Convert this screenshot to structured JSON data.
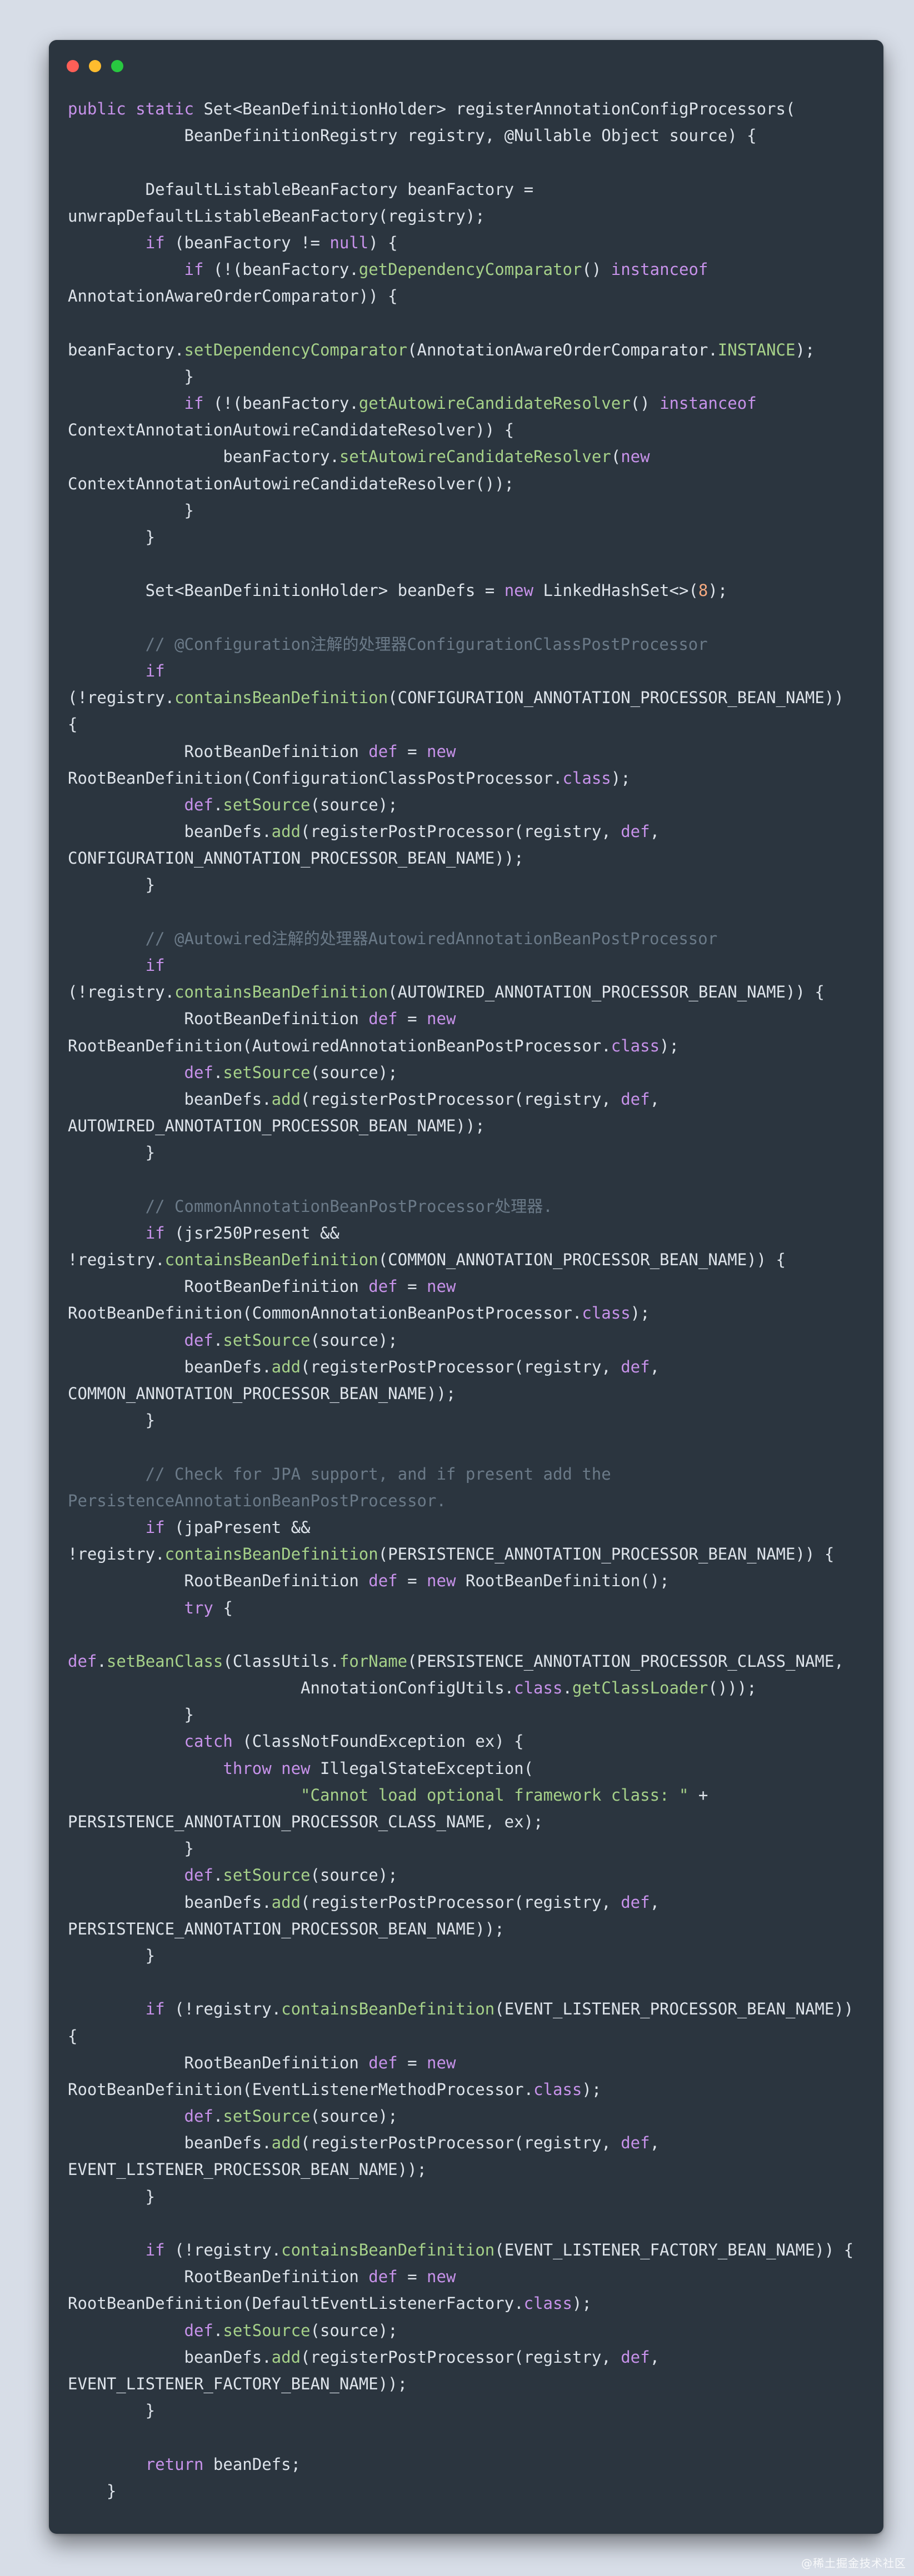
{
  "window": {
    "controls": [
      "close",
      "minimize",
      "maximize"
    ],
    "control_colors": {
      "close": "#ff5f57",
      "minimize": "#febc2e",
      "maximize": "#28c840"
    },
    "background": "#2b353f"
  },
  "colors": {
    "plain": "#dde3ea",
    "keyword": "#c792ea",
    "method": "#a6d189",
    "number": "#f5a97f",
    "string": "#a6d189",
    "comment": "#6b7a88",
    "page_background": "#d7dde7"
  },
  "code_lines": [
    [
      [
        "k",
        "public static "
      ],
      [
        "p",
        "Set<BeanDefinitionHolder> registerAnnotationConfigProcessors("
      ]
    ],
    [
      [
        "p",
        "            BeanDefinitionRegistry registry, @Nullable Object source) {"
      ]
    ],
    [],
    [
      [
        "p",
        "        DefaultListableBeanFactory beanFactory ="
      ]
    ],
    [
      [
        "p",
        "unwrapDefaultListableBeanFactory(registry);"
      ]
    ],
    [
      [
        "p",
        "        "
      ],
      [
        "k",
        "if"
      ],
      [
        "p",
        " (beanFactory != "
      ],
      [
        "k",
        "null"
      ],
      [
        "p",
        ") {"
      ]
    ],
    [
      [
        "p",
        "            "
      ],
      [
        "k",
        "if"
      ],
      [
        "p",
        " (!(beanFactory."
      ],
      [
        "m",
        "getDependencyComparator"
      ],
      [
        "p",
        "() "
      ],
      [
        "k",
        "instanceof"
      ]
    ],
    [
      [
        "p",
        "AnnotationAwareOrderComparator)) {"
      ]
    ],
    [],
    [
      [
        "p",
        "beanFactory."
      ],
      [
        "m",
        "setDependencyComparator"
      ],
      [
        "p",
        "(AnnotationAwareOrderComparator."
      ],
      [
        "m",
        "INSTANCE"
      ],
      [
        "p",
        ");"
      ]
    ],
    [
      [
        "p",
        "            }"
      ]
    ],
    [
      [
        "p",
        "            "
      ],
      [
        "k",
        "if"
      ],
      [
        "p",
        " (!(beanFactory."
      ],
      [
        "m",
        "getAutowireCandidateResolver"
      ],
      [
        "p",
        "() "
      ],
      [
        "k",
        "instanceof"
      ]
    ],
    [
      [
        "p",
        "ContextAnnotationAutowireCandidateResolver)) {"
      ]
    ],
    [
      [
        "p",
        "                beanFactory."
      ],
      [
        "m",
        "setAutowireCandidateResolver"
      ],
      [
        "p",
        "("
      ],
      [
        "k",
        "new"
      ]
    ],
    [
      [
        "p",
        "ContextAnnotationAutowireCandidateResolver());"
      ]
    ],
    [
      [
        "p",
        "            }"
      ]
    ],
    [
      [
        "p",
        "        }"
      ]
    ],
    [],
    [
      [
        "p",
        "        Set<BeanDefinitionHolder> beanDefs = "
      ],
      [
        "k",
        "new"
      ],
      [
        "p",
        " LinkedHashSet<>("
      ],
      [
        "n",
        "8"
      ],
      [
        "p",
        ");"
      ]
    ],
    [],
    [
      [
        "c",
        "        // @Configuration注解的处理器ConfigurationClassPostProcessor"
      ]
    ],
    [
      [
        "p",
        "        "
      ],
      [
        "k",
        "if"
      ]
    ],
    [
      [
        "p",
        "(!registry."
      ],
      [
        "m",
        "containsBeanDefinition"
      ],
      [
        "p",
        "(CONFIGURATION_ANNOTATION_PROCESSOR_BEAN_NAME))"
      ]
    ],
    [
      [
        "p",
        "{"
      ]
    ],
    [
      [
        "p",
        "            RootBeanDefinition "
      ],
      [
        "k",
        "def"
      ],
      [
        "p",
        " = "
      ],
      [
        "k",
        "new"
      ]
    ],
    [
      [
        "p",
        "RootBeanDefinition(ConfigurationClassPostProcessor."
      ],
      [
        "k",
        "class"
      ],
      [
        "p",
        ");"
      ]
    ],
    [
      [
        "p",
        "            "
      ],
      [
        "k",
        "def"
      ],
      [
        "p",
        "."
      ],
      [
        "m",
        "setSource"
      ],
      [
        "p",
        "(source);"
      ]
    ],
    [
      [
        "p",
        "            beanDefs."
      ],
      [
        "m",
        "add"
      ],
      [
        "p",
        "(registerPostProcessor(registry, "
      ],
      [
        "k",
        "def"
      ],
      [
        "p",
        ","
      ]
    ],
    [
      [
        "p",
        "CONFIGURATION_ANNOTATION_PROCESSOR_BEAN_NAME));"
      ]
    ],
    [
      [
        "p",
        "        }"
      ]
    ],
    [],
    [
      [
        "c",
        "        // @Autowired注解的处理器AutowiredAnnotationBeanPostProcessor"
      ]
    ],
    [
      [
        "p",
        "        "
      ],
      [
        "k",
        "if"
      ]
    ],
    [
      [
        "p",
        "(!registry."
      ],
      [
        "m",
        "containsBeanDefinition"
      ],
      [
        "p",
        "(AUTOWIRED_ANNOTATION_PROCESSOR_BEAN_NAME)) {"
      ]
    ],
    [
      [
        "p",
        "            RootBeanDefinition "
      ],
      [
        "k",
        "def"
      ],
      [
        "p",
        " = "
      ],
      [
        "k",
        "new"
      ]
    ],
    [
      [
        "p",
        "RootBeanDefinition(AutowiredAnnotationBeanPostProcessor."
      ],
      [
        "k",
        "class"
      ],
      [
        "p",
        ");"
      ]
    ],
    [
      [
        "p",
        "            "
      ],
      [
        "k",
        "def"
      ],
      [
        "p",
        "."
      ],
      [
        "m",
        "setSource"
      ],
      [
        "p",
        "(source);"
      ]
    ],
    [
      [
        "p",
        "            beanDefs."
      ],
      [
        "m",
        "add"
      ],
      [
        "p",
        "(registerPostProcessor(registry, "
      ],
      [
        "k",
        "def"
      ],
      [
        "p",
        ","
      ]
    ],
    [
      [
        "p",
        "AUTOWIRED_ANNOTATION_PROCESSOR_BEAN_NAME));"
      ]
    ],
    [
      [
        "p",
        "        }"
      ]
    ],
    [],
    [
      [
        "c",
        "        // CommonAnnotationBeanPostProcessor处理器."
      ]
    ],
    [
      [
        "p",
        "        "
      ],
      [
        "k",
        "if"
      ],
      [
        "p",
        " (jsr250Present &&"
      ]
    ],
    [
      [
        "p",
        "!registry."
      ],
      [
        "m",
        "containsBeanDefinition"
      ],
      [
        "p",
        "(COMMON_ANNOTATION_PROCESSOR_BEAN_NAME)) {"
      ]
    ],
    [
      [
        "p",
        "            RootBeanDefinition "
      ],
      [
        "k",
        "def"
      ],
      [
        "p",
        " = "
      ],
      [
        "k",
        "new"
      ]
    ],
    [
      [
        "p",
        "RootBeanDefinition(CommonAnnotationBeanPostProcessor."
      ],
      [
        "k",
        "class"
      ],
      [
        "p",
        ");"
      ]
    ],
    [
      [
        "p",
        "            "
      ],
      [
        "k",
        "def"
      ],
      [
        "p",
        "."
      ],
      [
        "m",
        "setSource"
      ],
      [
        "p",
        "(source);"
      ]
    ],
    [
      [
        "p",
        "            beanDefs."
      ],
      [
        "m",
        "add"
      ],
      [
        "p",
        "(registerPostProcessor(registry, "
      ],
      [
        "k",
        "def"
      ],
      [
        "p",
        ","
      ]
    ],
    [
      [
        "p",
        "COMMON_ANNOTATION_PROCESSOR_BEAN_NAME));"
      ]
    ],
    [
      [
        "p",
        "        }"
      ]
    ],
    [],
    [
      [
        "c",
        "        // Check for JPA support, and if present add the"
      ]
    ],
    [
      [
        "c",
        "PersistenceAnnotationBeanPostProcessor."
      ]
    ],
    [
      [
        "p",
        "        "
      ],
      [
        "k",
        "if"
      ],
      [
        "p",
        " (jpaPresent &&"
      ]
    ],
    [
      [
        "p",
        "!registry."
      ],
      [
        "m",
        "containsBeanDefinition"
      ],
      [
        "p",
        "(PERSISTENCE_ANNOTATION_PROCESSOR_BEAN_NAME)) {"
      ]
    ],
    [
      [
        "p",
        "            RootBeanDefinition "
      ],
      [
        "k",
        "def"
      ],
      [
        "p",
        " = "
      ],
      [
        "k",
        "new"
      ],
      [
        "p",
        " RootBeanDefinition();"
      ]
    ],
    [
      [
        "p",
        "            "
      ],
      [
        "k",
        "try"
      ],
      [
        "p",
        " {"
      ]
    ],
    [],
    [
      [
        "k",
        "def"
      ],
      [
        "p",
        "."
      ],
      [
        "m",
        "setBeanClass"
      ],
      [
        "p",
        "(ClassUtils."
      ],
      [
        "m",
        "forName"
      ],
      [
        "p",
        "(PERSISTENCE_ANNOTATION_PROCESSOR_CLASS_NAME,"
      ]
    ],
    [
      [
        "p",
        "                        AnnotationConfigUtils."
      ],
      [
        "k",
        "class"
      ],
      [
        "p",
        "."
      ],
      [
        "m",
        "getClassLoader"
      ],
      [
        "p",
        "()));"
      ]
    ],
    [
      [
        "p",
        "            }"
      ]
    ],
    [
      [
        "p",
        "            "
      ],
      [
        "k",
        "catch"
      ],
      [
        "p",
        " (ClassNotFoundException ex) {"
      ]
    ],
    [
      [
        "p",
        "                "
      ],
      [
        "k",
        "throw new"
      ],
      [
        "p",
        " IllegalStateException("
      ]
    ],
    [
      [
        "p",
        "                        "
      ],
      [
        "s",
        "\"Cannot load optional framework class: \""
      ],
      [
        "p",
        " +"
      ]
    ],
    [
      [
        "p",
        "PERSISTENCE_ANNOTATION_PROCESSOR_CLASS_NAME, ex);"
      ]
    ],
    [
      [
        "p",
        "            }"
      ]
    ],
    [
      [
        "p",
        "            "
      ],
      [
        "k",
        "def"
      ],
      [
        "p",
        "."
      ],
      [
        "m",
        "setSource"
      ],
      [
        "p",
        "(source);"
      ]
    ],
    [
      [
        "p",
        "            beanDefs."
      ],
      [
        "m",
        "add"
      ],
      [
        "p",
        "(registerPostProcessor(registry, "
      ],
      [
        "k",
        "def"
      ],
      [
        "p",
        ","
      ]
    ],
    [
      [
        "p",
        "PERSISTENCE_ANNOTATION_PROCESSOR_BEAN_NAME));"
      ]
    ],
    [
      [
        "p",
        "        }"
      ]
    ],
    [],
    [
      [
        "p",
        "        "
      ],
      [
        "k",
        "if"
      ],
      [
        "p",
        " (!registry."
      ],
      [
        "m",
        "containsBeanDefinition"
      ],
      [
        "p",
        "(EVENT_LISTENER_PROCESSOR_BEAN_NAME))"
      ]
    ],
    [
      [
        "p",
        "{"
      ]
    ],
    [
      [
        "p",
        "            RootBeanDefinition "
      ],
      [
        "k",
        "def"
      ],
      [
        "p",
        " = "
      ],
      [
        "k",
        "new"
      ]
    ],
    [
      [
        "p",
        "RootBeanDefinition(EventListenerMethodProcessor."
      ],
      [
        "k",
        "class"
      ],
      [
        "p",
        ");"
      ]
    ],
    [
      [
        "p",
        "            "
      ],
      [
        "k",
        "def"
      ],
      [
        "p",
        "."
      ],
      [
        "m",
        "setSource"
      ],
      [
        "p",
        "(source);"
      ]
    ],
    [
      [
        "p",
        "            beanDefs."
      ],
      [
        "m",
        "add"
      ],
      [
        "p",
        "(registerPostProcessor(registry, "
      ],
      [
        "k",
        "def"
      ],
      [
        "p",
        ","
      ]
    ],
    [
      [
        "p",
        "EVENT_LISTENER_PROCESSOR_BEAN_NAME));"
      ]
    ],
    [
      [
        "p",
        "        }"
      ]
    ],
    [],
    [
      [
        "p",
        "        "
      ],
      [
        "k",
        "if"
      ],
      [
        "p",
        " (!registry."
      ],
      [
        "m",
        "containsBeanDefinition"
      ],
      [
        "p",
        "(EVENT_LISTENER_FACTORY_BEAN_NAME)) {"
      ]
    ],
    [
      [
        "p",
        "            RootBeanDefinition "
      ],
      [
        "k",
        "def"
      ],
      [
        "p",
        " = "
      ],
      [
        "k",
        "new"
      ]
    ],
    [
      [
        "p",
        "RootBeanDefinition(DefaultEventListenerFactory."
      ],
      [
        "k",
        "class"
      ],
      [
        "p",
        ");"
      ]
    ],
    [
      [
        "p",
        "            "
      ],
      [
        "k",
        "def"
      ],
      [
        "p",
        "."
      ],
      [
        "m",
        "setSource"
      ],
      [
        "p",
        "(source);"
      ]
    ],
    [
      [
        "p",
        "            beanDefs."
      ],
      [
        "m",
        "add"
      ],
      [
        "p",
        "(registerPostProcessor(registry, "
      ],
      [
        "k",
        "def"
      ],
      [
        "p",
        ","
      ]
    ],
    [
      [
        "p",
        "EVENT_LISTENER_FACTORY_BEAN_NAME));"
      ]
    ],
    [
      [
        "p",
        "        }"
      ]
    ],
    [],
    [
      [
        "p",
        "        "
      ],
      [
        "k",
        "return"
      ],
      [
        "p",
        " beanDefs;"
      ]
    ],
    [
      [
        "p",
        "    }"
      ]
    ]
  ],
  "watermark": "@稀土掘金技术社区"
}
